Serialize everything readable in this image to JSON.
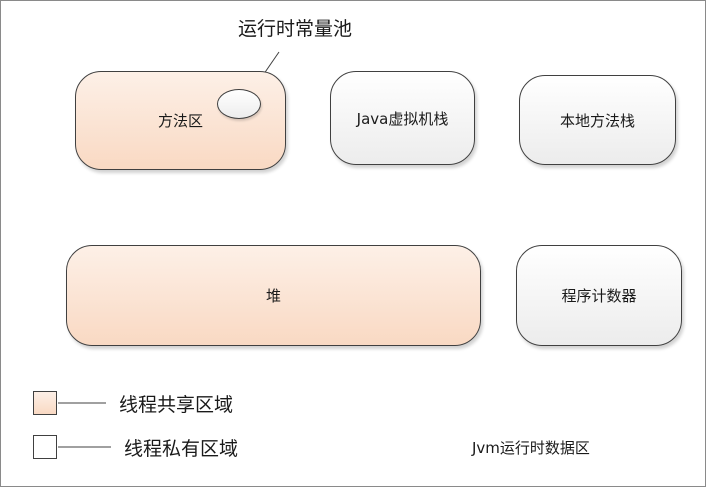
{
  "diagram": {
    "callout_label": "运行时常量池",
    "regions": {
      "method_area": "方法区",
      "java_vm_stack": "Java虚拟机栈",
      "native_method_stack": "本地方法栈",
      "heap": "堆",
      "program_counter": "程序计数器"
    },
    "legend": {
      "shared_label": "线程共享区域",
      "private_label": "线程私有区域"
    },
    "caption": "Jvm运行时数据区"
  },
  "colors": {
    "shared_fill": "#f9d9c3",
    "private_fill": "#ececec",
    "border": "#404040"
  }
}
